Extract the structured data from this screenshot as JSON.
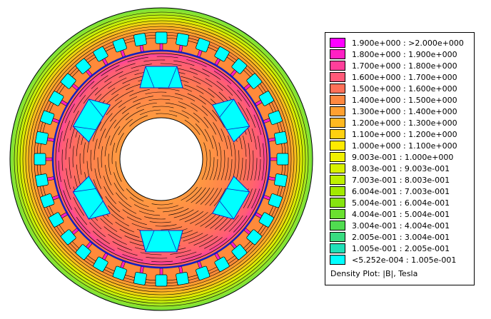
{
  "plot": {
    "title": "Density Plot: |B|, Tesla",
    "legend": [
      {
        "label": "1.900e+000 : >2.000e+000",
        "color": "#ff00ff"
      },
      {
        "label": "1.800e+000 : 1.900e+000",
        "color": "#ff20c4"
      },
      {
        "label": "1.700e+000 : 1.800e+000",
        "color": "#ff3f9a"
      },
      {
        "label": "1.600e+000 : 1.700e+000",
        "color": "#ff5a78"
      },
      {
        "label": "1.500e+000 : 1.600e+000",
        "color": "#ff7058"
      },
      {
        "label": "1.400e+000 : 1.500e+000",
        "color": "#ff8840"
      },
      {
        "label": "1.300e+000 : 1.400e+000",
        "color": "#ffa030"
      },
      {
        "label": "1.200e+000 : 1.300e+000",
        "color": "#ffb820"
      },
      {
        "label": "1.100e+000 : 1.200e+000",
        "color": "#ffd010"
      },
      {
        "label": "1.000e+000 : 1.100e+000",
        "color": "#ffea00"
      },
      {
        "label": "9.003e-001 : 1.000e+000",
        "color": "#f0f000"
      },
      {
        "label": "8.003e-001 : 9.003e-001",
        "color": "#d8f000"
      },
      {
        "label": "7.003e-001 : 8.003e-001",
        "color": "#bef000"
      },
      {
        "label": "6.004e-001 : 7.003e-001",
        "color": "#a2ea00"
      },
      {
        "label": "5.004e-001 : 6.004e-001",
        "color": "#86e410"
      },
      {
        "label": "4.004e-001 : 5.004e-001",
        "color": "#6ae030"
      },
      {
        "label": "3.004e-001 : 4.004e-001",
        "color": "#50dc50"
      },
      {
        "label": "2.005e-001 : 3.004e-001",
        "color": "#38dc80"
      },
      {
        "label": "1.005e-001 : 2.005e-001",
        "color": "#20e0b8"
      },
      {
        "label": "<5.252e-004 : 1.005e-001",
        "color": "#00ffff"
      }
    ]
  }
}
